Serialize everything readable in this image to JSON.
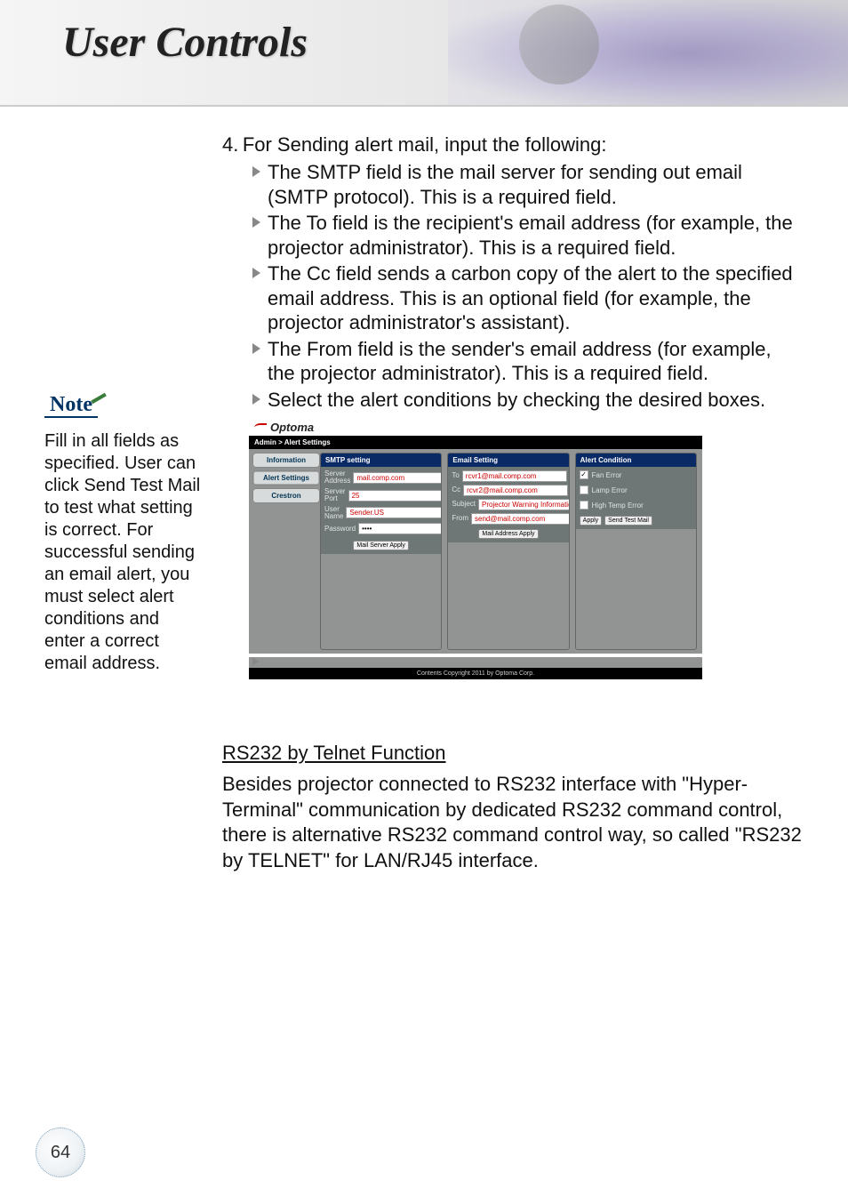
{
  "header": {
    "title": "User Controls"
  },
  "list": {
    "number": "4.",
    "lead": "For Sending alert mail, input the following:",
    "items": [
      "The SMTP field is the mail server for sending out email (SMTP protocol). This is a required field.",
      "The To field is the recipient's email address (for example, the projector administrator). This is a required field.",
      "The Cc field sends a carbon copy of the alert to the specified email address. This is an optional field (for example, the projector administrator's assistant).",
      "The From field is the sender's email address (for example, the projector administrator). This is a required field.",
      "Select the alert conditions by checking the desired boxes."
    ]
  },
  "note": {
    "label": "Note",
    "body": "Fill in all fields as specified. User can click Send Test Mail to test what setting is correct. For successful sending an email alert, you must select alert conditions and enter a correct email address."
  },
  "screenshot": {
    "brand": "Optoma",
    "breadcrumb": "Admin > Alert Settings",
    "tabs": [
      "Information",
      "Alert Settings",
      "Crestron"
    ],
    "smtp": {
      "title": "SMTP setting",
      "server_addr_label": "Server Address",
      "server_addr": "mail.comp.com",
      "server_port_label": "Server Port",
      "server_port": "25",
      "user_label": "User Name",
      "user": "Sender.US",
      "pwd_label": "Password",
      "pwd": "••••",
      "apply": "Mail Server Apply"
    },
    "email": {
      "title": "Email Setting",
      "to_label": "To",
      "to": "rcvr1@mail.comp.com",
      "cc_label": "Cc",
      "cc": "rcvr2@mail.comp.com",
      "subject_label": "Subject",
      "subject": "Projector Warning Information !",
      "from_label": "From",
      "from": "send@mail.comp.com",
      "apply": "Mail Address Apply"
    },
    "alert": {
      "title": "Alert Condition",
      "fan": "Fan Error",
      "lamp": "Lamp Error",
      "temp": "High Temp Error",
      "apply": "Apply",
      "test": "Send Test Mail"
    },
    "footer": "Contents Copyright 2011 by Optoma Corp."
  },
  "section": {
    "heading": "RS232 by Telnet Function",
    "body": "Besides projector connected to RS232 interface with \"Hyper-Terminal\" communication by dedicated RS232 command control, there is alternative RS232 command control way, so called \"RS232 by TELNET\" for LAN/RJ45 interface."
  },
  "page_number": "64"
}
